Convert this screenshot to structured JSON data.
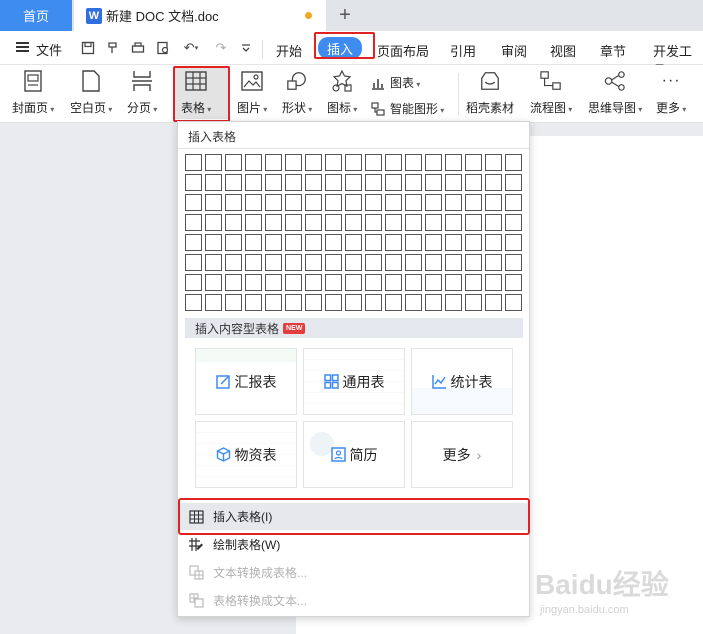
{
  "tabs": {
    "home": "首页",
    "doc": "新建 DOC 文档.doc",
    "doc_icon": "W",
    "add": "+"
  },
  "menu": {
    "file": "文件",
    "tabs": [
      "开始",
      "插入",
      "页面布局",
      "引用",
      "审阅",
      "视图",
      "章节",
      "开发工具"
    ],
    "active_tab": "插入"
  },
  "ribbon": {
    "cover": "封面页",
    "blank": "空白页",
    "pagebreak": "分页",
    "table": "表格",
    "picture": "图片",
    "shape": "形状",
    "icon": "图标",
    "chart": "图表",
    "smartart": "智能图形",
    "daoke": "稻壳素材",
    "flowchart": "流程图",
    "mindmap": "思维导图",
    "more": "更多"
  },
  "panel": {
    "title": "插入表格",
    "grid_cols": 17,
    "grid_rows": 8,
    "section_title": "插入内容型表格",
    "new_badge": "NEW",
    "cards": [
      "汇报表",
      "通用表",
      "统计表",
      "物资表",
      "简历",
      "更多"
    ],
    "items": [
      {
        "label": "插入表格(I)",
        "icon": "table-insert-icon",
        "disabled": false
      },
      {
        "label": "绘制表格(W)",
        "icon": "table-draw-icon",
        "disabled": false
      },
      {
        "label": "文本转换成表格...",
        "icon": "text-to-table-icon",
        "disabled": true
      },
      {
        "label": "表格转换成文本...",
        "icon": "table-to-text-icon",
        "disabled": true
      }
    ]
  },
  "watermark": {
    "brand": "Baidu经验",
    "url": "jingyan.baidu.com"
  },
  "colors": {
    "accent": "#3f8cf1",
    "highlight_box": "#e02222",
    "new_badge": "#e53c3c"
  }
}
